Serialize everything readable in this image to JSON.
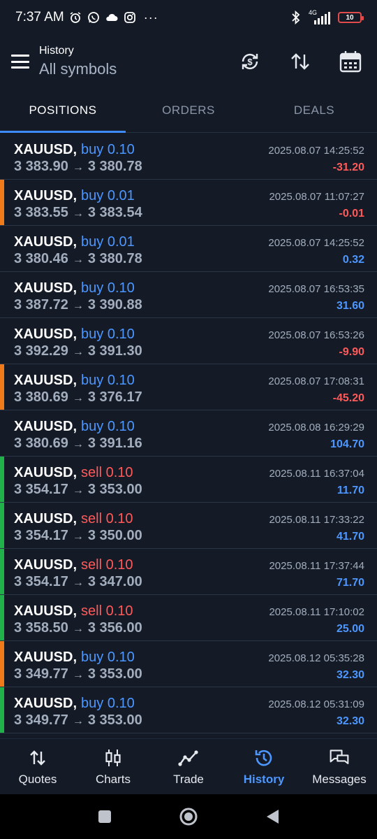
{
  "statusbar": {
    "time": "7:37 AM",
    "icons": [
      "alarm-icon",
      "whatsapp-icon",
      "cloud-icon",
      "instagram-icon"
    ],
    "more": "···",
    "network": "4G",
    "battery": "10"
  },
  "header": {
    "title": "History",
    "subtitle": "All symbols",
    "actions": [
      "sync-currency-icon",
      "sort-icon",
      "calendar-icon"
    ]
  },
  "tabs": [
    {
      "label": "POSITIONS",
      "active": true
    },
    {
      "label": "ORDERS",
      "active": false
    },
    {
      "label": "DEALS",
      "active": false
    }
  ],
  "arrow": "→",
  "colors": {
    "buy": "#4d97ff",
    "sell": "#ff5a5a",
    "bar_orange": "#f07a1a",
    "bar_green": "#21b14b",
    "tab_underline": "#3d8bfd"
  },
  "positions": [
    {
      "symbol": "XAUUSD,",
      "side": "buy",
      "volume": "buy 0.10",
      "open": "3 383.90",
      "close": "3 380.78",
      "time": "2025.08.07 14:25:52",
      "profit": "-31.20",
      "bar": "none"
    },
    {
      "symbol": "XAUUSD,",
      "side": "buy",
      "volume": "buy 0.01",
      "open": "3 383.55",
      "close": "3 383.54",
      "time": "2025.08.07 11:07:27",
      "profit": "-0.01",
      "bar": "orange"
    },
    {
      "symbol": "XAUUSD,",
      "side": "buy",
      "volume": "buy 0.01",
      "open": "3 380.46",
      "close": "3 380.78",
      "time": "2025.08.07 14:25:52",
      "profit": "0.32",
      "bar": "none"
    },
    {
      "symbol": "XAUUSD,",
      "side": "buy",
      "volume": "buy 0.10",
      "open": "3 387.72",
      "close": "3 390.88",
      "time": "2025.08.07 16:53:35",
      "profit": "31.60",
      "bar": "none"
    },
    {
      "symbol": "XAUUSD,",
      "side": "buy",
      "volume": "buy 0.10",
      "open": "3 392.29",
      "close": "3 391.30",
      "time": "2025.08.07 16:53:26",
      "profit": "-9.90",
      "bar": "none"
    },
    {
      "symbol": "XAUUSD,",
      "side": "buy",
      "volume": "buy 0.10",
      "open": "3 380.69",
      "close": "3 376.17",
      "time": "2025.08.07 17:08:31",
      "profit": "-45.20",
      "bar": "orange"
    },
    {
      "symbol": "XAUUSD,",
      "side": "buy",
      "volume": "buy 0.10",
      "open": "3 380.69",
      "close": "3 391.16",
      "time": "2025.08.08 16:29:29",
      "profit": "104.70",
      "bar": "none"
    },
    {
      "symbol": "XAUUSD,",
      "side": "sell",
      "volume": "sell 0.10",
      "open": "3 354.17",
      "close": "3 353.00",
      "time": "2025.08.11 16:37:04",
      "profit": "11.70",
      "bar": "green"
    },
    {
      "symbol": "XAUUSD,",
      "side": "sell",
      "volume": "sell 0.10",
      "open": "3 354.17",
      "close": "3 350.00",
      "time": "2025.08.11 17:33:22",
      "profit": "41.70",
      "bar": "green"
    },
    {
      "symbol": "XAUUSD,",
      "side": "sell",
      "volume": "sell 0.10",
      "open": "3 354.17",
      "close": "3 347.00",
      "time": "2025.08.11 17:37:44",
      "profit": "71.70",
      "bar": "green"
    },
    {
      "symbol": "XAUUSD,",
      "side": "sell",
      "volume": "sell 0.10",
      "open": "3 358.50",
      "close": "3 356.00",
      "time": "2025.08.11 17:10:02",
      "profit": "25.00",
      "bar": "green"
    },
    {
      "symbol": "XAUUSD,",
      "side": "buy",
      "volume": "buy 0.10",
      "open": "3 349.77",
      "close": "3 353.00",
      "time": "2025.08.12 05:35:28",
      "profit": "32.30",
      "bar": "orange"
    },
    {
      "symbol": "XAUUSD,",
      "side": "buy",
      "volume": "buy 0.10",
      "open": "3 349.77",
      "close": "3 353.00",
      "time": "2025.08.12 05:31:09",
      "profit": "32.30",
      "bar": "green"
    }
  ],
  "bottomnav": [
    {
      "label": "Quotes",
      "icon": "quotes-icon",
      "active": false
    },
    {
      "label": "Charts",
      "icon": "charts-icon",
      "active": false
    },
    {
      "label": "Trade",
      "icon": "trade-icon",
      "active": false
    },
    {
      "label": "History",
      "icon": "history-icon",
      "active": true
    },
    {
      "label": "Messages",
      "icon": "messages-icon",
      "active": false
    }
  ],
  "sysnav": [
    "recents-button",
    "home-button",
    "back-button"
  ]
}
